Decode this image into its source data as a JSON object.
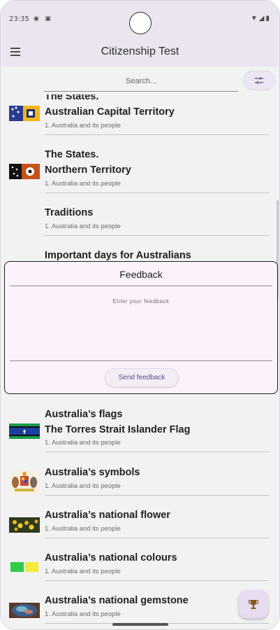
{
  "status_bar": {
    "time": "23:35"
  },
  "app_bar": {
    "title": "Citizenship Test"
  },
  "search": {
    "placeholder": "Search..."
  },
  "items": [
    {
      "line1": "The States.",
      "line2": "Australian Capital Territory",
      "subtitle": "1. Australia and its people",
      "thumb": "act-flag"
    },
    {
      "line1": "The States.",
      "line2": "Northern Territory",
      "subtitle": "1. Australia and its people",
      "thumb": "nt-flag"
    },
    {
      "line1": "Traditions",
      "subtitle": "1. Australia and its people",
      "thumb": ""
    },
    {
      "line1": "Important days for Australians",
      "subtitle": "",
      "thumb": ""
    },
    {
      "line1": "Australia’s flags",
      "line2": "The Torres Strait Islander Flag",
      "subtitle": "1. Australia and its people",
      "thumb": "torres-strait-flag"
    },
    {
      "line1": "Australia’s symbols",
      "subtitle": "1. Australia and its people",
      "thumb": "coat-of-arms"
    },
    {
      "line1": "Australia’s national flower",
      "subtitle": "1. Australia and its people",
      "thumb": "wattle"
    },
    {
      "line1": "Australia’s national colours",
      "subtitle": "1. Australia and its people",
      "thumb": "green-gold"
    },
    {
      "line1": "Australia’s national gemstone",
      "subtitle": "1. Australia and its people",
      "thumb": "opal"
    }
  ],
  "feedback": {
    "title": "Feedback",
    "placeholder": "Enter your feedback",
    "send_label": "Send feedback"
  },
  "icons": {
    "menu": "menu-icon",
    "filter": "tune-icon",
    "fab": "trophy-icon"
  },
  "colors": {
    "app_bar_bg": "#ebe5f0",
    "feedback_bg": "#fcf2fb",
    "accent": "#5a4e8c",
    "fab_bg": "#e8dcf2"
  }
}
